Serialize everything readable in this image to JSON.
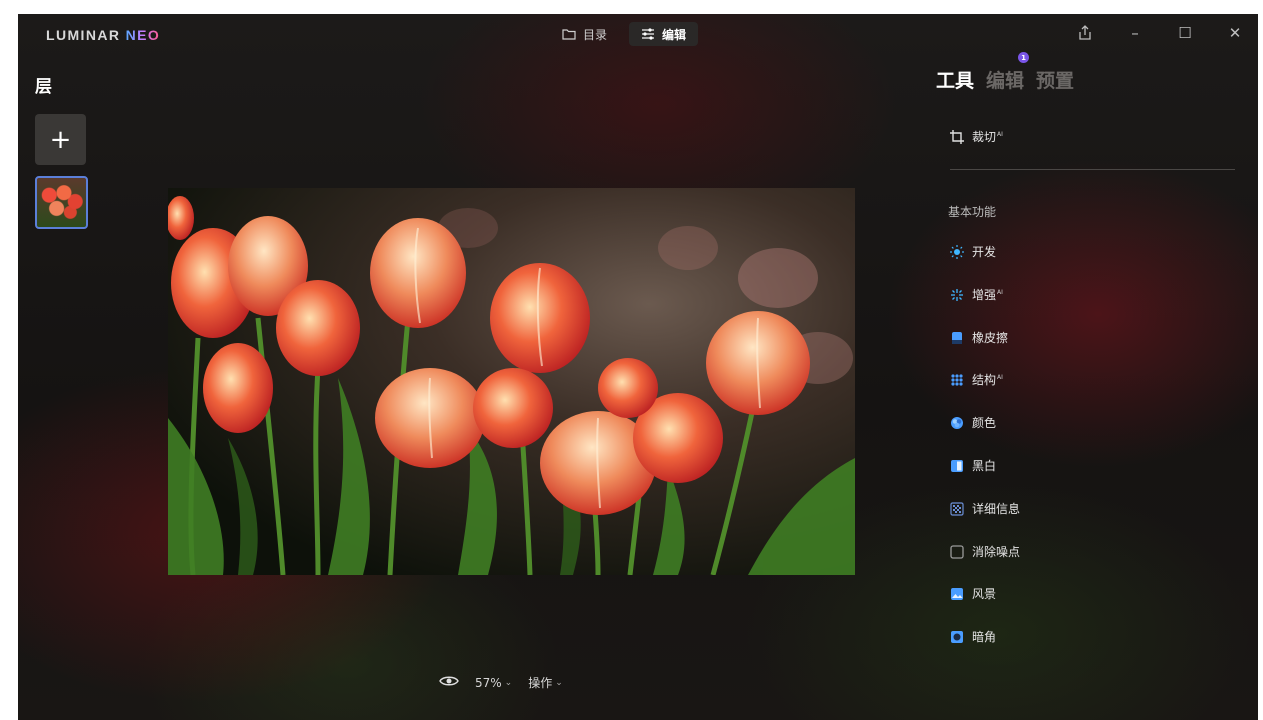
{
  "app": {
    "logo_main": "LUMINAR ",
    "logo_accent": "NEO"
  },
  "top_nav": {
    "catalog_label": "目录",
    "edit_label": "编辑",
    "active": "edit"
  },
  "window_controls": {
    "share_icon": "share-icon",
    "minimize": "–",
    "maximize": "☐",
    "close": "✕"
  },
  "layers": {
    "title": "层",
    "add_symbol": "+"
  },
  "bottom_bar": {
    "zoom": "57%",
    "actions_label": "操作"
  },
  "right_panel": {
    "tabs": [
      {
        "label": "工具",
        "active": true
      },
      {
        "label": "编辑",
        "badge": "1"
      },
      {
        "label": "预置"
      }
    ],
    "crop": {
      "label": "裁切",
      "ai": "AI"
    },
    "section_label": "基本功能",
    "tools": [
      {
        "label": "开发",
        "icon": "sun-icon",
        "color": "#3fb6ff",
        "ai": ""
      },
      {
        "label": "增强",
        "icon": "sparkle-icon",
        "color": "#3fb6ff",
        "ai": "AI"
      },
      {
        "label": "橡皮擦",
        "icon": "eraser-icon",
        "color": "#4a9dff",
        "ai": ""
      },
      {
        "label": "结构",
        "icon": "structure-icon",
        "color": "#4a9dff",
        "ai": "AI"
      },
      {
        "label": "颜色",
        "icon": "color-icon",
        "color": "#4a9dff",
        "ai": ""
      },
      {
        "label": "黑白",
        "icon": "bw-icon",
        "color": "#4a9dff",
        "ai": ""
      },
      {
        "label": "详细信息",
        "icon": "details-icon",
        "color": "#6b8fd6",
        "ai": ""
      },
      {
        "label": "消除噪点",
        "icon": "denoise-icon",
        "color": "#9a9a9a",
        "ai": ""
      },
      {
        "label": "风景",
        "icon": "landscape-icon",
        "color": "#4a9dff",
        "ai": ""
      },
      {
        "label": "暗角",
        "icon": "vignette-icon",
        "color": "#4a9dff",
        "ai": ""
      }
    ]
  },
  "photo": {
    "subject": "tulips-photo"
  }
}
